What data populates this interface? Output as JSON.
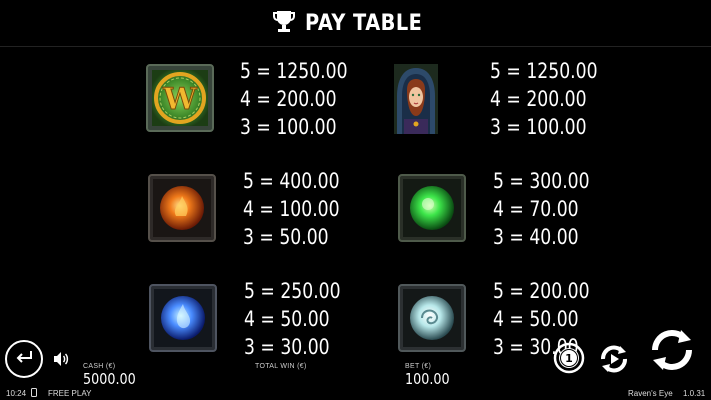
{
  "header": {
    "title": "PAY TABLE",
    "icon": "trophy-icon"
  },
  "paytable": [
    {
      "symbol": "wild-w-symbol",
      "lines": [
        "5 = 1250.00",
        "4 = 200.00",
        "3 = 100.00"
      ]
    },
    {
      "symbol": "hooded-woman-symbol",
      "lines": [
        "5 = 1250.00",
        "4 = 200.00",
        "3 = 100.00"
      ]
    },
    {
      "symbol": "orange-fire-stone-symbol",
      "lines": [
        "5 = 400.00",
        "4 = 100.00",
        "3 = 50.00"
      ]
    },
    {
      "symbol": "green-stone-symbol",
      "lines": [
        "5 = 300.00",
        "4 = 70.00",
        "3 = 40.00"
      ]
    },
    {
      "symbol": "blue-water-stone-symbol",
      "lines": [
        "5 = 250.00",
        "4 = 50.00",
        "3 = 30.00"
      ]
    },
    {
      "symbol": "white-wind-stone-symbol",
      "lines": [
        "5 = 200.00",
        "4 = 50.00",
        "3 = 30.00"
      ]
    }
  ],
  "footer": {
    "cash_label": "CASH (€)",
    "cash_value": "5000.00",
    "total_win_label": "TOTAL WIN (€)",
    "total_win_value": "",
    "bet_label": "BET (€)",
    "bet_value": "100.00",
    "coin_value": "1"
  },
  "status_bar": {
    "time": "10:24",
    "mode": "FREE PLAY",
    "game_name": "Raven's Eye",
    "version": "1.0.31"
  },
  "colors": {
    "background": "#000000",
    "text": "#ffffff",
    "frame": "#3d4a3c",
    "wild_green": "#3f8a2a",
    "wild_gold": "#e2a520",
    "fire_orange": "#f07a1a",
    "green_gem": "#3de64a",
    "blue_gem": "#4a8cff",
    "white_gem": "#c8f0f0"
  }
}
